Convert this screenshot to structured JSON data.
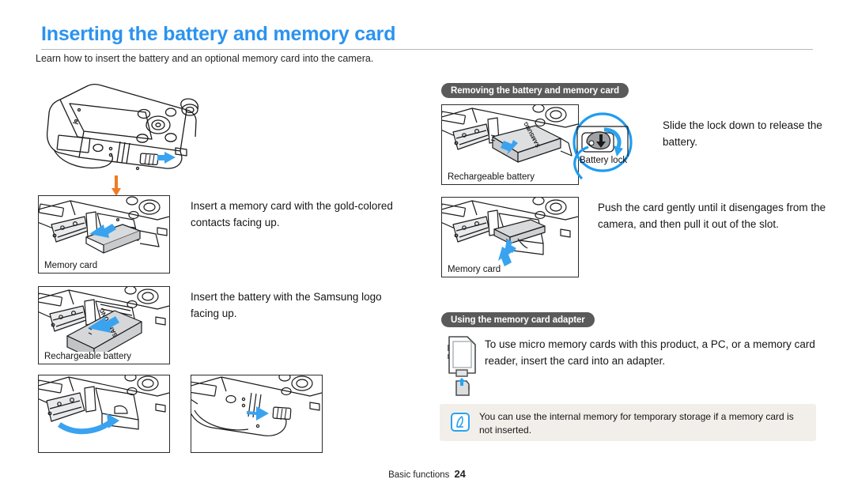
{
  "header": {
    "title": "Inserting the battery and memory card",
    "subtitle": "Learn how to insert the battery and an optional memory card into the camera.",
    "title_color": "#2b93ef"
  },
  "left_column": {
    "steps": [
      {
        "figure_caption": "Memory card",
        "text": "Insert a memory card with the gold-colored contacts facing up."
      },
      {
        "figure_caption": "Rechargeable battery",
        "text": "Insert the battery with the Samsung logo facing up."
      }
    ],
    "top_figure_name": "camera-body-open-cover",
    "bottom_figures": [
      "camera-cover-closing",
      "camera-lock-slide"
    ]
  },
  "right_column": {
    "section_removing": {
      "pill_label": "Removing the battery and memory card",
      "steps": [
        {
          "figure_caption": "Rechargeable battery",
          "callout_label": "Battery lock",
          "text": "Slide the lock down to release the battery."
        },
        {
          "figure_caption": "Memory card",
          "text": "Push the card gently until it disengages from the camera, and then pull it out of the slot."
        }
      ]
    },
    "section_adapter": {
      "pill_label": "Using the memory card adapter",
      "text": "To use micro memory cards with this product, a PC, or a memory card reader, insert the card into an adapter.",
      "figure_name": "sd-card-adapter-icon"
    }
  },
  "note": {
    "icon": "note-pen-icon",
    "text": "You can use the internal memory for temporary storage if a memory card is not inserted.",
    "background": "#f2efea"
  },
  "footer": {
    "section": "Basic functions",
    "page_number": "24"
  },
  "colors": {
    "accent_blue": "#2b93ef",
    "arrow_blue": "#3aa3f0",
    "arrow_orange": "#ef7a23",
    "pill_gray": "#5a5a5a",
    "line_gray": "#b9b9b9"
  }
}
